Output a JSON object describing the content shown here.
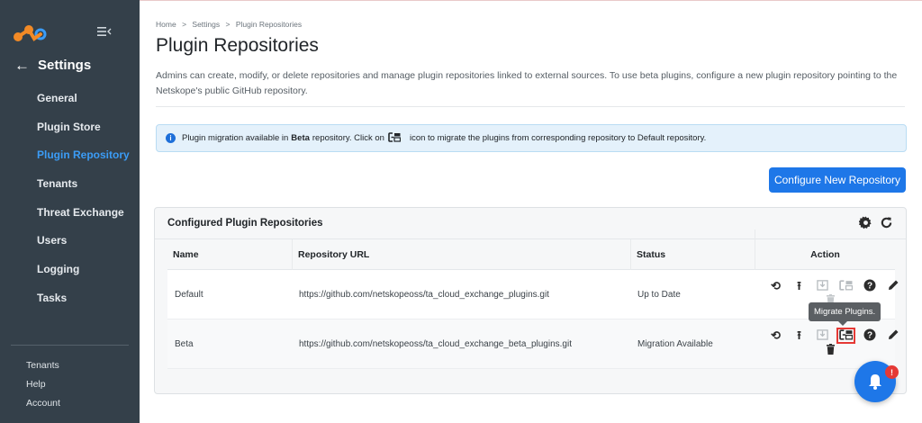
{
  "sidebar": {
    "back_label": "Settings",
    "items": [
      {
        "label": "General"
      },
      {
        "label": "Plugin Store"
      },
      {
        "label": "Plugin Repository"
      },
      {
        "label": "Tenants"
      },
      {
        "label": "Threat Exchange"
      },
      {
        "label": "Users"
      },
      {
        "label": "Logging"
      },
      {
        "label": "Tasks"
      }
    ],
    "bottom_links": [
      {
        "label": "Tenants"
      },
      {
        "label": "Help"
      },
      {
        "label": "Account"
      }
    ],
    "active_color": "#3b9cf6",
    "bg_color": "#34404a"
  },
  "breadcrumb": [
    "Home",
    ">",
    "Settings",
    ">",
    "Plugin Repositories"
  ],
  "page": {
    "title": "Plugin Repositories",
    "description": "Admins can create, modify, or delete repositories and manage plugin repositories linked to external sources. To use beta plugins, configure a new plugin repository pointing to the Netskope's public GitHub repository."
  },
  "alert": {
    "text_before": "Plugin migration available in",
    "bold": "Beta",
    "text_middle": "repository. Click on",
    "text_after": "icon to migrate the plugins from corresponding repository to Default repository."
  },
  "configure_button": "Configure New Repository",
  "card": {
    "title": "Configured Plugin Repositories",
    "columns": [
      "Name",
      "Repository URL",
      "Status",
      "Action"
    ],
    "rows": [
      {
        "name": "Default",
        "url": "https://github.com/netskopeoss/ta_cloud_exchange_plugins.git",
        "status": "Up to Date"
      },
      {
        "name": "Beta",
        "url": "https://github.com/netskopeoss/ta_cloud_exchange_beta_plugins.git",
        "status": "Migration Available"
      }
    ]
  },
  "tooltip": "Migrate Plugins.",
  "notification_badge": "!",
  "accent_color": "#1e77e8"
}
